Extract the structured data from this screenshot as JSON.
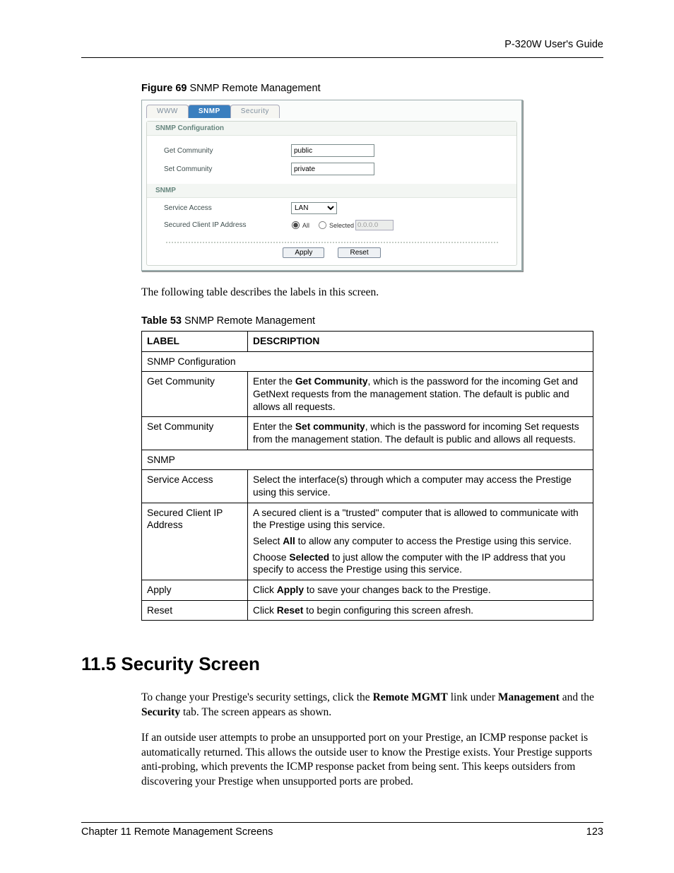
{
  "header": {
    "doc_title": "P-320W User's Guide"
  },
  "figure": {
    "caption_bold": "Figure 69",
    "caption_rest": "   SNMP Remote Management",
    "tabs": {
      "www": "WWW",
      "snmp": "SNMP",
      "security": "Security"
    },
    "sec1": {
      "title": "SNMP Configuration",
      "get_label": "Get Community",
      "get_value": "public",
      "set_label": "Set Community",
      "set_value": "private"
    },
    "sec2": {
      "title": "SNMP",
      "sa_label": "Service Access",
      "sa_value": "LAN",
      "scip_label": "Secured Client IP Address",
      "radio_all": "All",
      "radio_sel": "Selected",
      "ip_value": "0.0.0.0"
    },
    "buttons": {
      "apply": "Apply",
      "reset": "Reset"
    }
  },
  "intro_para": "The following table describes the labels in this screen.",
  "table_caption_bold": "Table 53",
  "table_caption_rest": "   SNMP Remote Management",
  "table": {
    "th_label": "LABEL",
    "th_desc": "DESCRIPTION",
    "rows": {
      "snmp_conf": "SNMP Configuration",
      "get_label": "Get Community",
      "get_desc_a": "Enter the ",
      "get_desc_b": "Get Community",
      "get_desc_c": ", which is the password for the incoming Get and GetNext requests from the management station. The default is public and allows all requests.",
      "set_label": "Set Community",
      "set_desc_a": "Enter the ",
      "set_desc_b": "Set community",
      "set_desc_c": ", which is the password for incoming Set requests from the management station. The default is public and allows all requests.",
      "snmp_row": "SNMP",
      "sa_label": "Service Access",
      "sa_desc": "Select the interface(s) through which a computer may access the Prestige using this service.",
      "scip_label": "Secured Client IP Address",
      "scip_p1": "A secured client is a \"trusted\" computer that is allowed to communicate with the Prestige using this service.",
      "scip_p2a": "Select ",
      "scip_p2b": "All",
      "scip_p2c": " to allow any computer to access the Prestige using this service.",
      "scip_p3a": "Choose ",
      "scip_p3b": "Selected",
      "scip_p3c": " to just allow the computer with the IP address that you specify to access the Prestige using this service.",
      "apply_label": "Apply",
      "apply_desc_a": "Click ",
      "apply_desc_b": "Apply",
      "apply_desc_c": " to save your changes back to the Prestige.",
      "reset_label": "Reset",
      "reset_desc_a": "Click ",
      "reset_desc_b": "Reset",
      "reset_desc_c": " to begin configuring this screen afresh."
    }
  },
  "section": {
    "heading": "11.5  Security Screen",
    "p1_a": "To change your Prestige's security settings, click the ",
    "p1_b": "Remote MGMT",
    "p1_c": " link under ",
    "p1_d": "Management",
    "p1_e": " and the ",
    "p1_f": "Security",
    "p1_g": " tab. The screen appears as shown.",
    "p2": "If an outside user attempts to probe an unsupported port on your Prestige, an ICMP response packet is automatically returned.  This allows the outside user to know the Prestige exists. Your Prestige supports anti-probing, which prevents the ICMP response packet from being sent. This keeps outsiders from discovering your Prestige when unsupported ports are probed."
  },
  "footer": {
    "chapter": "Chapter 11 Remote Management Screens",
    "page": "123"
  }
}
